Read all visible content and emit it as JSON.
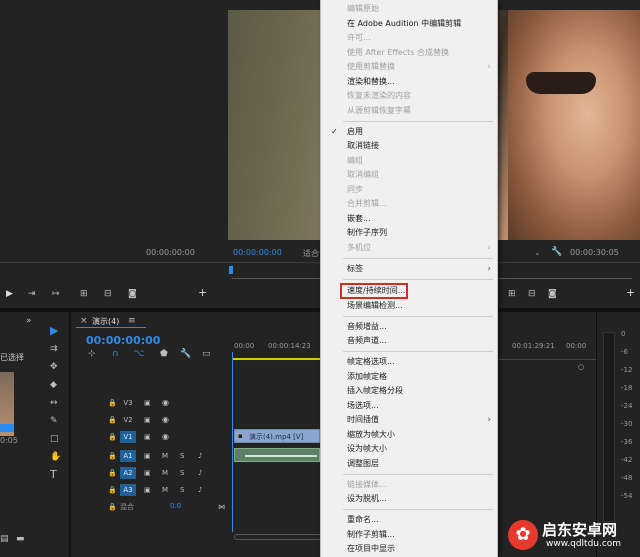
{
  "source_monitor": {
    "timecode": "00:00:00:00"
  },
  "program_monitor": {
    "timecode": "00:00:00:00",
    "fit_label": "适合",
    "end_timecode": "00:00:30:05"
  },
  "project": {
    "label": "已选择",
    "time": "0:05"
  },
  "timeline": {
    "tab_title": "演示(4)",
    "timecode": "00:00:00:00",
    "ruler": [
      "00:00",
      "00:00:14:23",
      "00:01:29:21",
      "00:00"
    ],
    "tracks": [
      {
        "label": "V3"
      },
      {
        "label": "V2"
      },
      {
        "label": "V1"
      },
      {
        "label": "A1"
      },
      {
        "label": "A2"
      },
      {
        "label": "A3"
      }
    ],
    "mix_label": "混合",
    "mix_value": "0.0",
    "clip_video_label": "演示(4).mp4 [V]"
  },
  "meters": {
    "ticks": [
      "0",
      "-6",
      "-12",
      "-18",
      "-24",
      "-30",
      "-36",
      "-42",
      "-48",
      "-54"
    ]
  },
  "context_menu": {
    "items": [
      {
        "label": "编辑原始",
        "disabled": true
      },
      {
        "label": "在 Adobe Audition 中编辑剪辑",
        "disabled": false
      },
      {
        "label": "许可...",
        "disabled": true
      },
      {
        "label": "使用 After Effects 合成替换",
        "disabled": true
      },
      {
        "label": "使用剪辑替换",
        "disabled": true,
        "submenu": true
      },
      {
        "label": "渲染和替换...",
        "disabled": false
      },
      {
        "label": "恢复未渲染的内容",
        "disabled": true
      },
      {
        "label": "从源剪辑恢复字幕",
        "disabled": true
      },
      {
        "label": "启用",
        "disabled": false,
        "checked": true
      },
      {
        "label": "取消链接",
        "disabled": false
      },
      {
        "label": "编组",
        "disabled": true
      },
      {
        "label": "取消编组",
        "disabled": true
      },
      {
        "label": "同步",
        "disabled": true
      },
      {
        "label": "合并剪辑...",
        "disabled": true
      },
      {
        "label": "嵌套...",
        "disabled": false
      },
      {
        "label": "制作子序列",
        "disabled": false
      },
      {
        "label": "多机位",
        "disabled": true,
        "submenu": true
      },
      {
        "label": "标签",
        "disabled": false,
        "submenu": true
      },
      {
        "label": "速度/持续时间...",
        "disabled": false,
        "highlighted": true
      },
      {
        "label": "场景编辑检测...",
        "disabled": false
      },
      {
        "label": "音频增益...",
        "disabled": false
      },
      {
        "label": "音频声道...",
        "disabled": false
      },
      {
        "label": "帧定格选项...",
        "disabled": false
      },
      {
        "label": "添加帧定格",
        "disabled": false
      },
      {
        "label": "插入帧定格分段",
        "disabled": false
      },
      {
        "label": "场选项...",
        "disabled": false
      },
      {
        "label": "时间插值",
        "disabled": false,
        "submenu": true
      },
      {
        "label": "缩放为帧大小",
        "disabled": false
      },
      {
        "label": "设为帧大小",
        "disabled": false
      },
      {
        "label": "调整图层",
        "disabled": false
      },
      {
        "label": "链接媒体...",
        "disabled": true
      },
      {
        "label": "设为脱机...",
        "disabled": false
      },
      {
        "label": "重命名...",
        "disabled": false
      },
      {
        "label": "制作子剪辑...",
        "disabled": false
      },
      {
        "label": "在项目中显示",
        "disabled": false
      }
    ]
  },
  "watermark": {
    "title": "启东安卓网",
    "url": "www.qdltdu.com"
  }
}
